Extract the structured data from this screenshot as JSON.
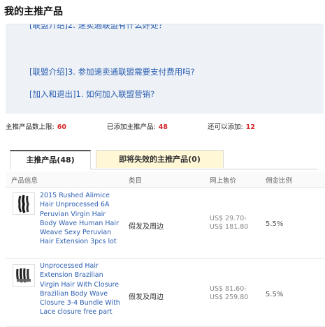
{
  "page": {
    "title": "我的主推产品"
  },
  "faq": {
    "links": [
      {
        "text": "[联盟介绍]2. 速卖通联盟有什么好处？"
      },
      {
        "text": "[联盟介绍]3. 参加速卖通联盟需要支付费用吗?"
      },
      {
        "text": "[加入和退出]1. 如何加入联盟营销?"
      }
    ]
  },
  "stats": {
    "limit_label": "主推产品数上限:",
    "limit_value": "60",
    "added_label": "已添加主推产品:",
    "added_value": "48",
    "remaining_label": "还可以添加:",
    "remaining_value": "12"
  },
  "tabs": [
    {
      "label": "主推产品(48)",
      "active": true
    },
    {
      "label": "即将失效的主推产品(0)",
      "active": false
    }
  ],
  "table": {
    "headers": [
      "产品信息",
      "类目",
      "网上售价",
      "佣金比例"
    ],
    "rows": [
      {
        "name": "2015 Rushed Alimice Hair Unprocessed 6A Peruvian Virgin Hair Body Wave Human Hair Weave Sexy Peruvian Hair Extension 3pcs lot",
        "category": "假发及周边",
        "price_low": "US$ 29.70-",
        "price_high": "US$ 181.80",
        "commission": "5.5%"
      },
      {
        "name": "Unprocessed Hair Extension Brazilian Virgin Hair With Closure Brazilian Body Wave Closure 3-4 Bundle With Lace closure free part",
        "category": "假发及周边",
        "price_low": "US$ 81.60-",
        "price_high": "US$ 259.80",
        "commission": "5.5%"
      }
    ]
  },
  "colors": {
    "link": "#2a5db0",
    "highlight": "#d6272b",
    "tab_inactive_bg": "#fff7d6"
  }
}
